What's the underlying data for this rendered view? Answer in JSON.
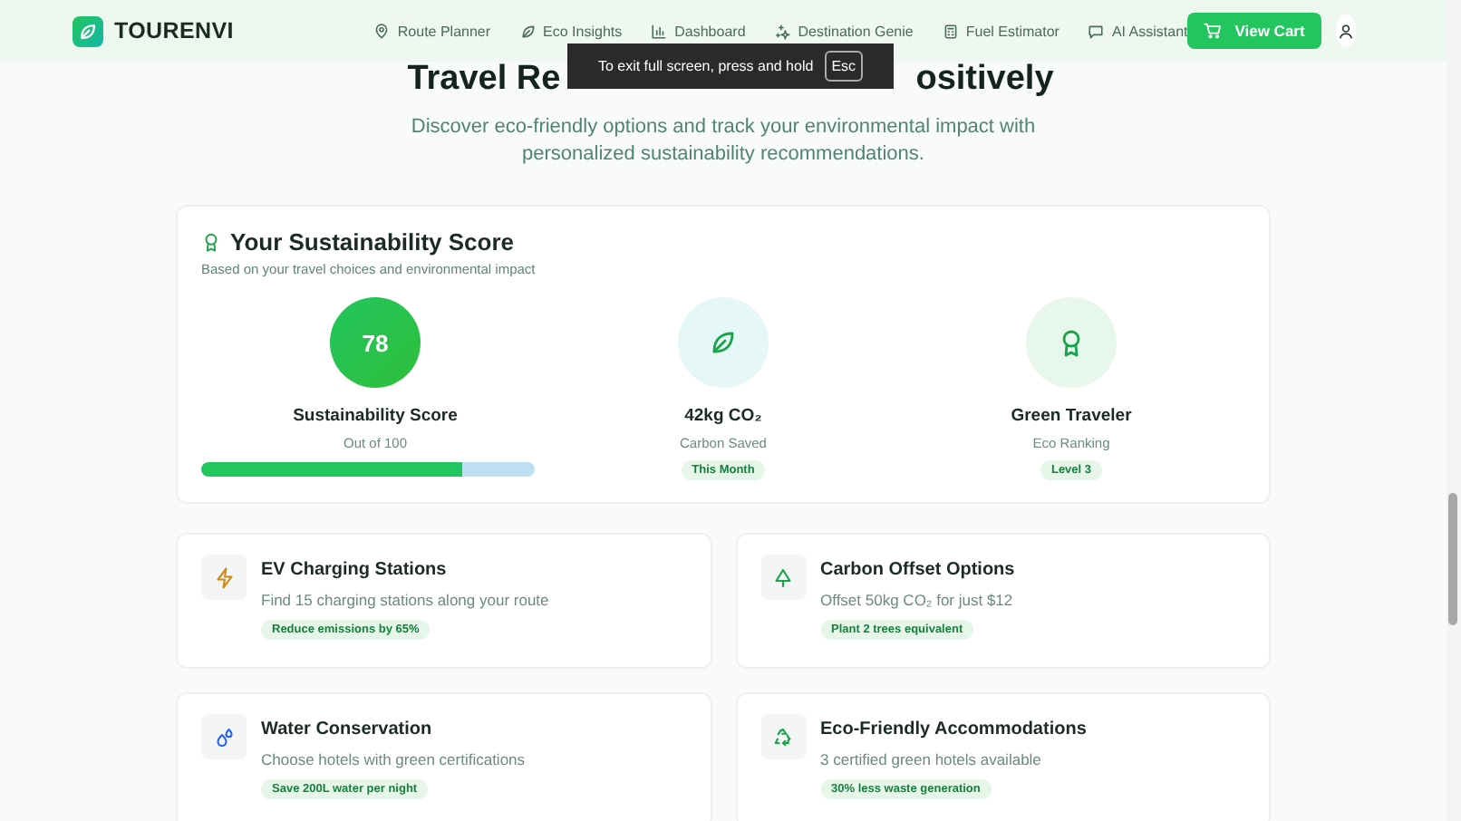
{
  "header": {
    "brand": "TOURENVI",
    "nav": [
      {
        "label": "Route Planner",
        "kind": "pin"
      },
      {
        "label": "Eco Insights",
        "kind": "leaf"
      },
      {
        "label": "Dashboard",
        "kind": "chart"
      },
      {
        "label": "Destination Genie",
        "kind": "sparkle"
      },
      {
        "label": "Fuel Estimator",
        "kind": "calc"
      },
      {
        "label": "AI Assistant",
        "kind": "chat"
      }
    ],
    "cart_button": "View Cart"
  },
  "fullscreen_notice": {
    "text": "To exit full screen, press and hold",
    "key": "Esc"
  },
  "hero": {
    "title_start": "Travel Re",
    "title_end": "ositively",
    "subtitle": "Discover eco-friendly options and track your environmental impact with personalized sustainability recommendations."
  },
  "score_card": {
    "title": "Your Sustainability Score",
    "subtitle": "Based on your travel choices and environmental impact",
    "stats": [
      {
        "kind": "score",
        "value": "78",
        "label": "Sustainability Score",
        "caption": "Out of 100",
        "level": 0.78
      },
      {
        "kind": "leaf",
        "label": "42kg CO₂",
        "caption": "Carbon Saved",
        "badge": "This Month"
      },
      {
        "kind": "award",
        "label": "Green Traveler",
        "caption": "Eco Ranking",
        "badge": "Level 3"
      }
    ]
  },
  "tips": [
    {
      "kind": "bolt",
      "title": "EV Charging Stations",
      "text": "Find 15 charging stations along your route",
      "badge": "Reduce emissions by 65%"
    },
    {
      "kind": "tree",
      "title": "Carbon Offset Options",
      "text": "Offset 50kg CO₂ for just $12",
      "badge": "Plant 2 trees equivalent"
    },
    {
      "kind": "drops",
      "title": "Water Conservation",
      "text": "Choose hotels with green certifications",
      "badge": "Save 200L water per night"
    },
    {
      "kind": "recycle",
      "title": "Eco-Friendly Accommodations",
      "text": "3 certified green hotels available",
      "badge": "30% less waste generation"
    }
  ]
}
